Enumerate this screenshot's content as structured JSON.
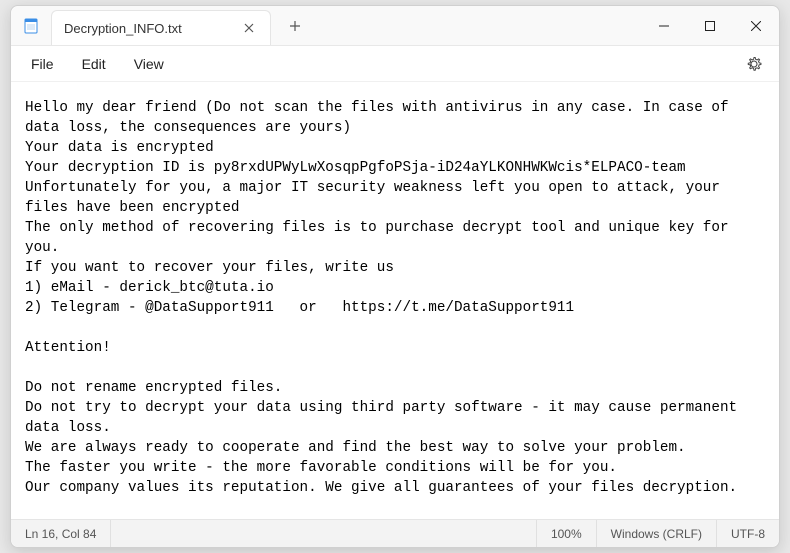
{
  "tab": {
    "title": "Decryption_INFO.txt"
  },
  "menu": {
    "file": "File",
    "edit": "Edit",
    "view": "View"
  },
  "body": "Hello my dear friend (Do not scan the files with antivirus in any case. In case of data loss, the consequences are yours)\nYour data is encrypted\nYour decryption ID is py8rxdUPWyLwXosqpPgfoPSja-iD24aYLKONHWKWcis*ELPACO-team\nUnfortunately for you, a major IT security weakness left you open to attack, your files have been encrypted\nThe only method of recovering files is to purchase decrypt tool and unique key for you.\nIf you want to recover your files, write us\n1) eMail - derick_btc@tuta.io\n2) Telegram - @DataSupport911   or   https://t.me/DataSupport911\n\nAttention!\n\nDo not rename encrypted files.\nDo not try to decrypt your data using third party software - it may cause permanent data loss.\nWe are always ready to cooperate and find the best way to solve your problem.\nThe faster you write - the more favorable conditions will be for you.\nOur company values its reputation. We give all guarantees of your files decryption.",
  "status": {
    "cursor": "Ln 16, Col 84",
    "zoom": "100%",
    "lineend": "Windows (CRLF)",
    "encoding": "UTF-8"
  }
}
